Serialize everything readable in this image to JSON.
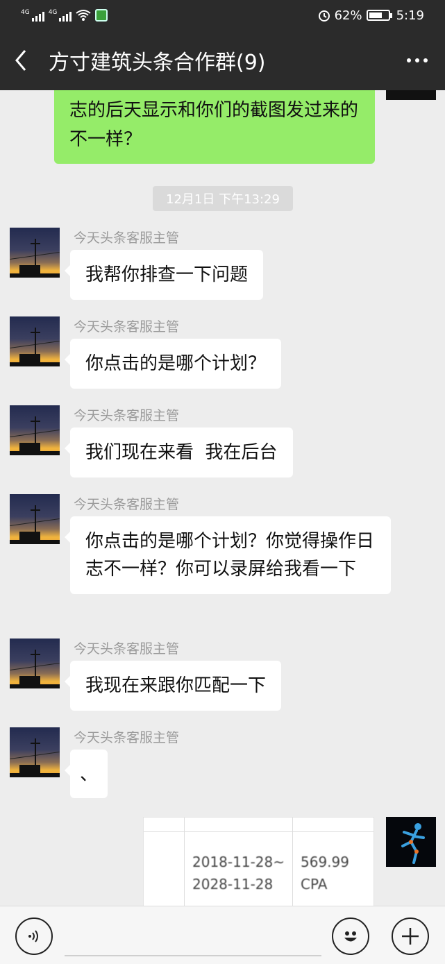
{
  "status_bar": {
    "signal1_label": "4G",
    "signal2_label": "4G",
    "battery_percent": "62%",
    "time": "5:19"
  },
  "header": {
    "title": "方寸建筑头条合作群(9)"
  },
  "messages": {
    "top_outgoing_text": "志的后天显示和你们的截图发过来的 不一样？",
    "timestamp": "12月1日 下午13:29",
    "incoming": [
      {
        "sender": "今天头条客服主管",
        "text": "我帮你排查一下问题"
      },
      {
        "sender": "今天头条客服主管",
        "text": "你点击的是哪个计划？"
      },
      {
        "sender": "今天头条客服主管",
        "text": "我们现在来看  我在后台"
      },
      {
        "sender": "今天头条客服主管",
        "text": "你点击的是哪个计划？你觉得操作日志不一样？你可以录屏给我看一下"
      },
      {
        "sender": "今天头条客服主管",
        "text": "我现在来跟你匹配一下"
      },
      {
        "sender": "今天头条客服主管",
        "text": "、"
      }
    ],
    "image_message": {
      "date_range_line1": "2018-11-28~",
      "date_range_line2": "2028-11-28",
      "amount": "569.99",
      "type": "CPA"
    }
  },
  "icons": {
    "back": "chevron-left-icon",
    "more": "more-dots-icon",
    "voice": "voice-icon",
    "emoji": "emoji-icon",
    "plus": "plus-icon"
  }
}
